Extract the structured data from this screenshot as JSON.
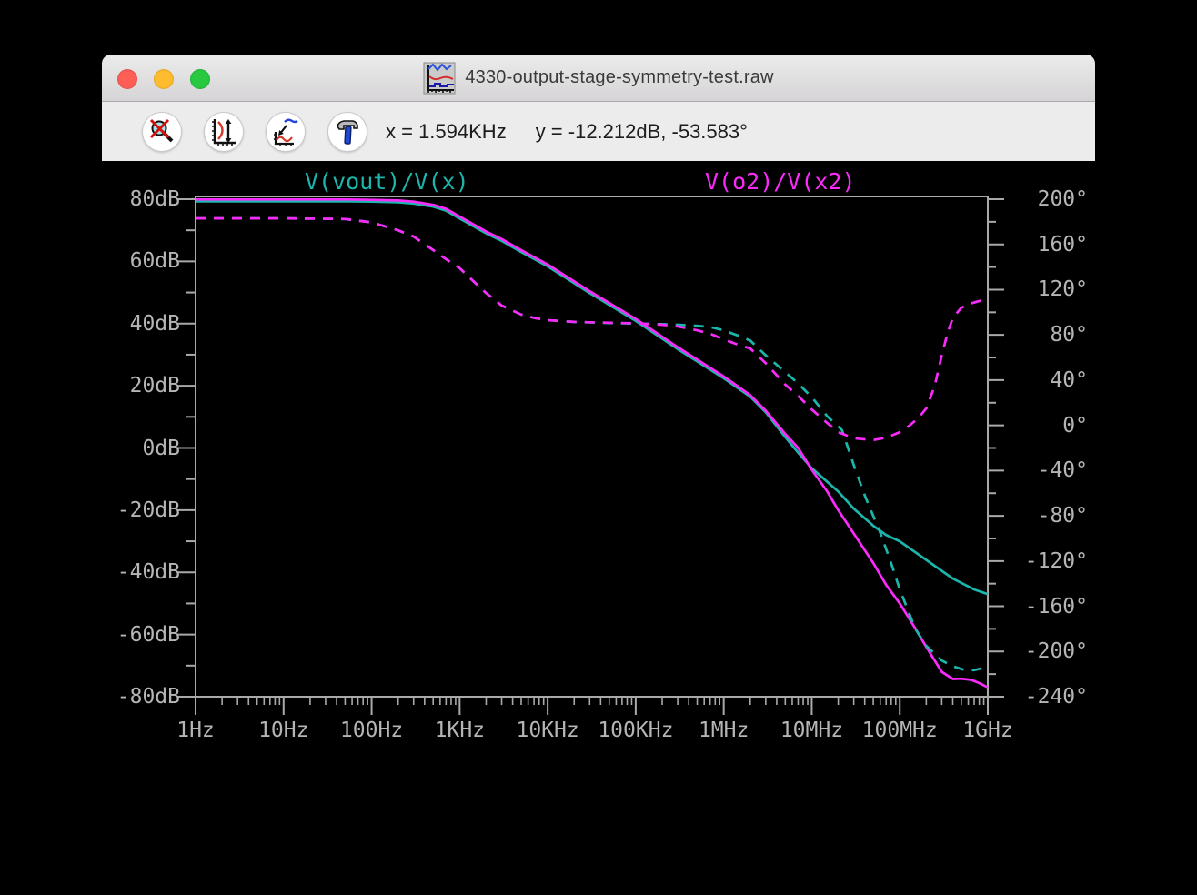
{
  "window": {
    "title": "4330-output-stage-symmetry-test.raw",
    "traffic_lights": [
      {
        "name": "close",
        "color": "#fd5f57"
      },
      {
        "name": "minimize",
        "color": "#febc2e"
      },
      {
        "name": "zoom",
        "color": "#28c840"
      }
    ]
  },
  "toolbar": {
    "buttons": [
      {
        "name": "zoom-back",
        "icon": "magnifier-red-x-icon"
      },
      {
        "name": "autorange-y",
        "icon": "axis-vertical-arrows-icon"
      },
      {
        "name": "zoom-fit",
        "icon": "curve-arrow-icon"
      },
      {
        "name": "settings",
        "icon": "hammer-icon"
      }
    ],
    "readout_x": "x = 1.594KHz",
    "readout_y": "y = -12.212dB, -53.583°"
  },
  "colors": {
    "background": "#000000",
    "axis": "#a9a9a9",
    "axis_text": "#b5b5b5",
    "trace_cyan": "#1cb5ab",
    "trace_magenta": "#fa2bfa"
  },
  "chart_data": {
    "type": "line",
    "x_axis": {
      "scale": "log",
      "unit": "Hz",
      "min": 1,
      "max": 1000000000,
      "tick_labels": [
        "1Hz",
        "10Hz",
        "100Hz",
        "1KHz",
        "10KHz",
        "100KHz",
        "1MHz",
        "10MHz",
        "100MHz",
        "1GHz"
      ]
    },
    "y_left": {
      "unit": "dB",
      "min": -80,
      "max": 80,
      "major_step": 20,
      "minor_step": 10,
      "tick_labels": [
        "80dB",
        "60dB",
        "40dB",
        "20dB",
        "0dB",
        "-20dB",
        "-40dB",
        "-60dB",
        "-80dB"
      ]
    },
    "y_right": {
      "unit": "deg",
      "min": -240,
      "max": 200,
      "major_step": 40,
      "minor_step": 20,
      "tick_labels": [
        "200°",
        "160°",
        "120°",
        "80°",
        "40°",
        "0°",
        "-40°",
        "-80°",
        "-120°",
        "-160°",
        "-200°",
        "-240°"
      ]
    },
    "legend": [
      {
        "label": "V(vout)/V(x)",
        "color": "#1cb5ab"
      },
      {
        "label": "V(o2)/V(x2)",
        "color": "#fa2bfa"
      }
    ],
    "series": [
      {
        "name": "V(vout)/V(x)",
        "component": "magnitude",
        "axis": "left",
        "color": "#1cb5ab",
        "style": "solid",
        "points": [
          [
            1,
            79.3
          ],
          [
            10,
            79.3
          ],
          [
            50,
            79.3
          ],
          [
            100,
            79.2
          ],
          [
            200,
            79.0
          ],
          [
            300,
            78.6
          ],
          [
            500,
            77.6
          ],
          [
            700,
            76.3
          ],
          [
            1000,
            73.8
          ],
          [
            1500,
            71.0
          ],
          [
            2000,
            69.0
          ],
          [
            3000,
            66.6
          ],
          [
            5000,
            63.0
          ],
          [
            10000,
            58.4
          ],
          [
            30000,
            49.8
          ],
          [
            100000,
            40.9
          ],
          [
            300000,
            31.8
          ],
          [
            1000000,
            22.4
          ],
          [
            2000000,
            16.5
          ],
          [
            3000000,
            11.5
          ],
          [
            5000000,
            3.5
          ],
          [
            7000000,
            -1.5
          ],
          [
            10000000,
            -6.5
          ],
          [
            20000000,
            -14.0
          ],
          [
            30000000,
            -19.5
          ],
          [
            50000000,
            -25.0
          ],
          [
            70000000,
            -28.0
          ],
          [
            100000000,
            -30.0
          ],
          [
            200000000,
            -36.0
          ],
          [
            400000000,
            -42.0
          ],
          [
            700000000,
            -45.5
          ],
          [
            1000000000,
            -47.0
          ]
        ]
      },
      {
        "name": "V(o2)/V(x2)",
        "component": "magnitude",
        "axis": "left",
        "color": "#fa2bfa",
        "style": "solid",
        "points": [
          [
            1,
            79.9
          ],
          [
            10,
            79.9
          ],
          [
            50,
            79.9
          ],
          [
            100,
            79.8
          ],
          [
            200,
            79.6
          ],
          [
            300,
            79.2
          ],
          [
            500,
            78.2
          ],
          [
            700,
            76.9
          ],
          [
            1000,
            74.4
          ],
          [
            1500,
            71.6
          ],
          [
            2000,
            69.6
          ],
          [
            3000,
            67.2
          ],
          [
            5000,
            63.6
          ],
          [
            10000,
            59.0
          ],
          [
            30000,
            50.4
          ],
          [
            100000,
            41.5
          ],
          [
            300000,
            32.4
          ],
          [
            1000000,
            23.0
          ],
          [
            2000000,
            17.0
          ],
          [
            3000000,
            12.0
          ],
          [
            5000000,
            4.5
          ],
          [
            7000000,
            0.0
          ],
          [
            10000000,
            -7.0
          ],
          [
            15000000,
            -14.0
          ],
          [
            20000000,
            -20.0
          ],
          [
            30000000,
            -27.5
          ],
          [
            50000000,
            -37.0
          ],
          [
            70000000,
            -44.0
          ],
          [
            100000000,
            -50.0
          ],
          [
            150000000,
            -58.0
          ],
          [
            200000000,
            -64.0
          ],
          [
            300000000,
            -72.0
          ],
          [
            400000000,
            -74.3
          ],
          [
            500000000,
            -74.2
          ],
          [
            650000000,
            -74.6
          ],
          [
            800000000,
            -75.6
          ],
          [
            1000000000,
            -77.0
          ]
        ]
      },
      {
        "name": "V(vout)/V(x)",
        "component": "phase",
        "axis": "right",
        "color": "#1cb5ab",
        "style": "dashed",
        "points": [
          [
            1,
            183
          ],
          [
            10,
            183
          ],
          [
            50,
            182.5
          ],
          [
            100,
            179.5
          ],
          [
            200,
            172.5
          ],
          [
            300,
            167
          ],
          [
            500,
            155
          ],
          [
            700,
            147
          ],
          [
            1000,
            139
          ],
          [
            1500,
            126
          ],
          [
            2000,
            117
          ],
          [
            3000,
            106
          ],
          [
            5000,
            98
          ],
          [
            7000,
            95
          ],
          [
            10000,
            93
          ],
          [
            20000,
            91.5
          ],
          [
            50000,
            90.5
          ],
          [
            100000,
            90
          ],
          [
            200000,
            89.5
          ],
          [
            300000,
            89
          ],
          [
            500000,
            88
          ],
          [
            700000,
            87
          ],
          [
            1000000,
            84
          ],
          [
            1500000,
            79
          ],
          [
            2000000,
            75
          ],
          [
            3000000,
            62
          ],
          [
            5000000,
            47
          ],
          [
            7000000,
            37
          ],
          [
            10000000,
            25
          ],
          [
            15000000,
            8
          ],
          [
            22000000,
            -4
          ],
          [
            30000000,
            -35
          ],
          [
            40000000,
            -62
          ],
          [
            60000000,
            -95
          ],
          [
            80000000,
            -122
          ],
          [
            100000000,
            -145
          ],
          [
            150000000,
            -180
          ],
          [
            200000000,
            -195
          ],
          [
            300000000,
            -208
          ],
          [
            400000000,
            -213
          ],
          [
            550000000,
            -216.5
          ],
          [
            700000000,
            -216.5
          ],
          [
            900000000,
            -214.5
          ],
          [
            1000000000,
            -213.5
          ]
        ]
      },
      {
        "name": "V(o2)/V(x2)",
        "component": "phase",
        "axis": "right",
        "color": "#fa2bfa",
        "style": "dashed",
        "points": [
          [
            1,
            183
          ],
          [
            10,
            183
          ],
          [
            50,
            182.5
          ],
          [
            100,
            179.5
          ],
          [
            200,
            172.5
          ],
          [
            300,
            167
          ],
          [
            500,
            155
          ],
          [
            700,
            147
          ],
          [
            1000,
            139
          ],
          [
            1500,
            126
          ],
          [
            2000,
            117
          ],
          [
            3000,
            106
          ],
          [
            5000,
            98
          ],
          [
            7000,
            95
          ],
          [
            10000,
            93
          ],
          [
            20000,
            91.5
          ],
          [
            50000,
            90.8
          ],
          [
            100000,
            90.3
          ],
          [
            200000,
            89
          ],
          [
            300000,
            87.5
          ],
          [
            500000,
            84
          ],
          [
            700000,
            81
          ],
          [
            1000000,
            76
          ],
          [
            1500000,
            71
          ],
          [
            2000000,
            68
          ],
          [
            3000000,
            55
          ],
          [
            5000000,
            36
          ],
          [
            7000000,
            26
          ],
          [
            10000000,
            14
          ],
          [
            15000000,
            2
          ],
          [
            20000000,
            -6
          ],
          [
            30000000,
            -11.5
          ],
          [
            50000000,
            -13
          ],
          [
            70000000,
            -11
          ],
          [
            100000000,
            -6
          ],
          [
            130000000,
            0
          ],
          [
            160000000,
            6
          ],
          [
            200000000,
            15
          ],
          [
            250000000,
            35
          ],
          [
            300000000,
            62
          ],
          [
            350000000,
            82
          ],
          [
            400000000,
            95
          ],
          [
            500000000,
            104
          ],
          [
            650000000,
            108
          ],
          [
            800000000,
            110
          ],
          [
            1000000000,
            111
          ]
        ]
      }
    ]
  }
}
